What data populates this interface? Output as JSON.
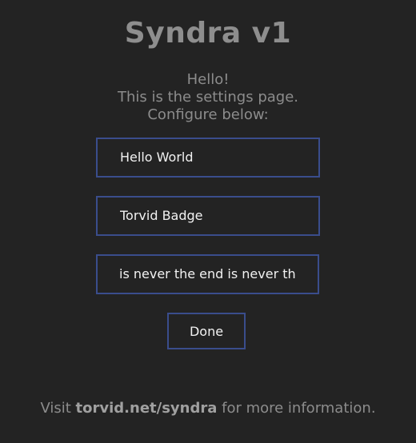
{
  "app": {
    "title": "Syndra v1"
  },
  "intro": {
    "line1": "Hello!",
    "line2": "This is the settings page.",
    "line3": "Configure below:"
  },
  "fields": {
    "field1_value": "Hello World",
    "field2_value": "Torvid Badge",
    "field3_value": "is never the end is never th"
  },
  "actions": {
    "done_label": "Done"
  },
  "footer": {
    "prefix": "Visit ",
    "link": "torvid.net/syndra",
    "suffix": " for more information."
  },
  "colors": {
    "background": "#232323",
    "border": "#3a4d8c",
    "text_muted": "#8c8c8c",
    "text_bright": "#f2f2f2"
  }
}
